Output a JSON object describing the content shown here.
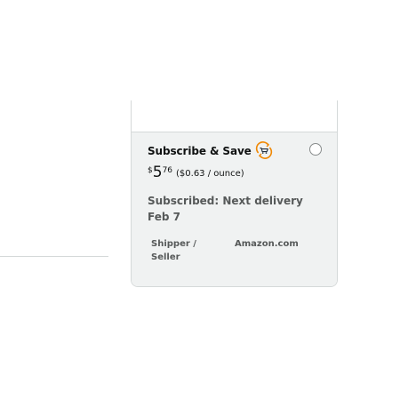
{
  "offer": {
    "title": "Subscribe & Save",
    "icon": "subscribe-save-cart-icon",
    "price": {
      "symbol": "$",
      "whole": "5",
      "fraction": "76"
    },
    "unit_price": "($0.63 / ounce)",
    "status": "Subscribed: Next delivery Feb 7",
    "shipper_label": "Shipper / Seller",
    "shipper_value": "Amazon.com",
    "selected": false
  },
  "colors": {
    "accent": "#f08804",
    "card_bg": "#f0f2f2",
    "border": "#d5d9d9",
    "secondary_text": "#565959"
  }
}
